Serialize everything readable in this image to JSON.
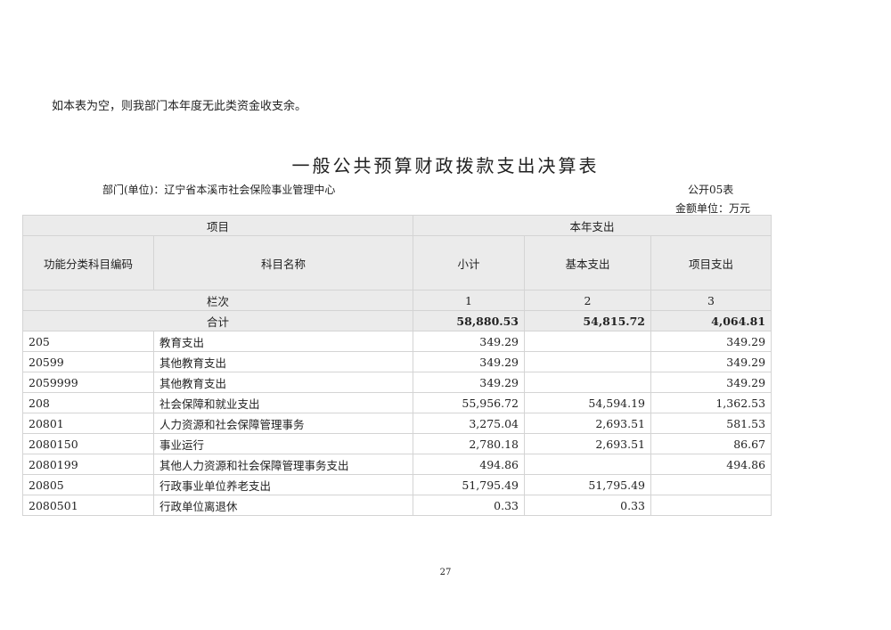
{
  "note": "如本表为空，则我部门本年度无此类资金收支余。",
  "title": "一般公共预算财政拨款支出决算表",
  "department": "部门(单位)：辽宁省本溪市社会保险事业管理中心",
  "table_no": "公开05表",
  "unit": "金额单位：万元",
  "headers": {
    "project": "项目",
    "current_year": "本年支出",
    "code": "功能分类科目编码",
    "name": "科目名称",
    "subtotal": "小计",
    "basic": "基本支出",
    "program": "项目支出",
    "column_label": "栏次",
    "col1": "1",
    "col2": "2",
    "col3": "3"
  },
  "total": {
    "label": "合计",
    "subtotal": "58,880.53",
    "basic": "54,815.72",
    "program": "4,064.81"
  },
  "rows": [
    {
      "code": "205",
      "name": "教育支出",
      "subtotal": "349.29",
      "basic": "",
      "program": "349.29"
    },
    {
      "code": "20599",
      "name": "其他教育支出",
      "subtotal": "349.29",
      "basic": "",
      "program": "349.29"
    },
    {
      "code": "2059999",
      "name": "其他教育支出",
      "subtotal": "349.29",
      "basic": "",
      "program": "349.29"
    },
    {
      "code": "208",
      "name": "社会保障和就业支出",
      "subtotal": "55,956.72",
      "basic": "54,594.19",
      "program": "1,362.53"
    },
    {
      "code": "20801",
      "name": "人力资源和社会保障管理事务",
      "subtotal": "3,275.04",
      "basic": "2,693.51",
      "program": "581.53"
    },
    {
      "code": "2080150",
      "name": "事业运行",
      "subtotal": "2,780.18",
      "basic": "2,693.51",
      "program": "86.67"
    },
    {
      "code": "2080199",
      "name": "其他人力资源和社会保障管理事务支出",
      "subtotal": "494.86",
      "basic": "",
      "program": "494.86"
    },
    {
      "code": "20805",
      "name": "行政事业单位养老支出",
      "subtotal": "51,795.49",
      "basic": "51,795.49",
      "program": ""
    },
    {
      "code": "2080501",
      "name": "行政单位离退休",
      "subtotal": "0.33",
      "basic": "0.33",
      "program": ""
    }
  ],
  "page_number": "27"
}
